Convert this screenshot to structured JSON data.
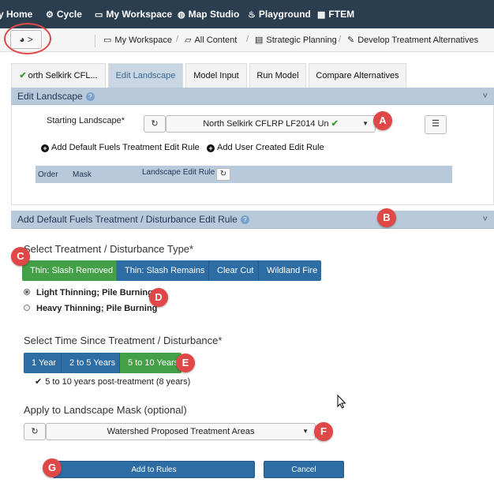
{
  "topnav": {
    "items": [
      {
        "icon": "globe-icon",
        "label": "y Home"
      },
      {
        "icon": "cycle-icon",
        "label": "Cycle"
      },
      {
        "icon": "workspace-icon",
        "label": "My Workspace"
      },
      {
        "icon": "globe-icon",
        "label": "Map Studio"
      },
      {
        "icon": "flame-icon",
        "label": "Playground"
      },
      {
        "icon": "calculator-icon",
        "label": "FTEM"
      }
    ]
  },
  "toolbar": {
    "nav_button": "◕ >"
  },
  "breadcrumb": [
    {
      "icon": "folder-icon",
      "label": "My Workspace"
    },
    {
      "icon": "folder-open-icon",
      "label": "All Content"
    },
    {
      "icon": "book-icon",
      "label": "Strategic Planning"
    },
    {
      "icon": "pencil-icon",
      "label": "Develop Treatment Alternatives"
    }
  ],
  "tabs": [
    {
      "label": "orth Selkirk CFL...",
      "checked": true
    },
    {
      "label": "Edit Landscape",
      "active": true
    },
    {
      "label": "Model Input"
    },
    {
      "label": "Run Model"
    },
    {
      "label": "Compare Alternatives"
    }
  ],
  "edit_landscape": {
    "title": "Edit Landscape",
    "starting_label": "Starting Landscape*",
    "starting_value": "North Selkirk CFLRP LF2014 Un",
    "add_default_rule": "Add Default Fuels Treatment Edit Rule",
    "add_user_rule": "Add User Created Edit Rule",
    "table_headers": {
      "order": "Order",
      "mask": "Mask",
      "rule": "Landscape Edit Rule"
    }
  },
  "default_rule": {
    "title": "Add Default Fuels Treatment / Disturbance Edit Rule",
    "type_title": "Select Treatment / Disturbance Type*",
    "types": [
      "Thin: Slash Removed",
      "Thin: Slash Remains",
      "Clear Cut",
      "Wildland Fire"
    ],
    "selected_type": "Thin: Slash Removed",
    "options": [
      {
        "label": "Light Thinning; Pile Burning",
        "selected": true
      },
      {
        "label": "Heavy Thinning; Pile Burning",
        "selected": false
      }
    ],
    "time_title": "Select Time Since Treatment / Disturbance*",
    "times": [
      "1 Year",
      "2 to 5 Years",
      "5 to 10 Years"
    ],
    "selected_time": "5 to 10 Years",
    "time_note": "5 to 10 years post-treatment (8 years)",
    "mask_title": "Apply to Landscape Mask (optional)",
    "mask_value": "Watershed Proposed Treatment Areas",
    "add_button": "Add to Rules",
    "cancel_button": "Cancel"
  },
  "markers": {
    "a": "A",
    "b": "B",
    "c": "C",
    "d": "D",
    "e": "E",
    "f": "F",
    "g": "G"
  },
  "colors": {
    "nav_bg": "#2b3e50",
    "panel_head": "#b8c9dc",
    "primary": "#2e6da4",
    "success": "#43a047",
    "marker": "#e04848"
  }
}
